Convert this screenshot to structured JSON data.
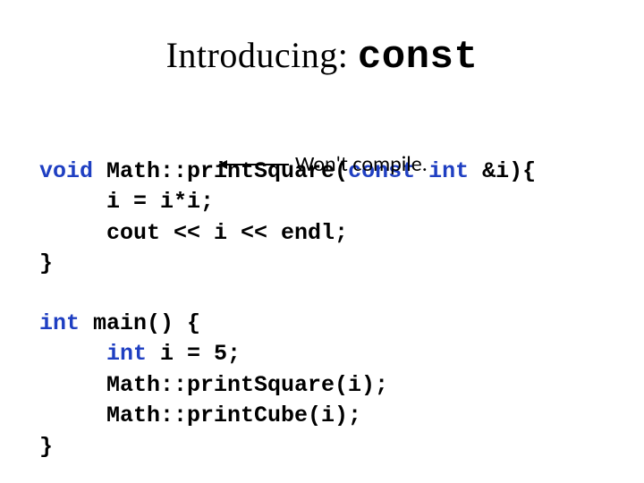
{
  "title": {
    "prefix": "Introducing: ",
    "keyword": "const"
  },
  "block1": {
    "sig": {
      "kw_void": "void",
      "name": " Math::printSquare(",
      "kw_const": "const",
      "kw_int": " int",
      "rest": " &i){"
    },
    "l2": "     i = i*i;",
    "l3": "     cout << i << endl;",
    "l4": "}"
  },
  "annotation": {
    "text": "Won't compile."
  },
  "block2": {
    "sig": {
      "kw_int": "int",
      "rest": " main() {"
    },
    "l2a": "     ",
    "l2b": "int",
    "l2c": " i = 5;",
    "l3": "     Math::printSquare(i);",
    "l4": "     Math::printCube(i);",
    "l5": "}"
  }
}
